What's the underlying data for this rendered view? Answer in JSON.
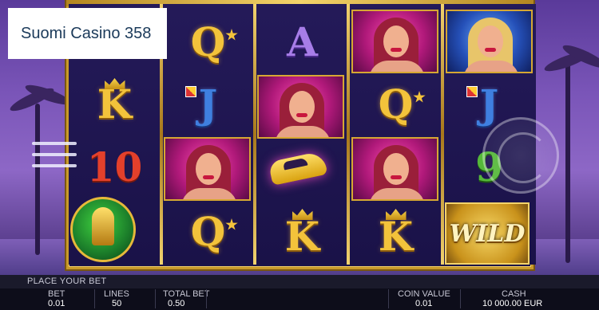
{
  "logo": {
    "text": "Suomi Casino 358"
  },
  "bottom_bar": {
    "place_bet": "PLACE YOUR BET",
    "bet_label": "BET",
    "bet_value": "0.01",
    "lines_label": "LINES",
    "lines_value": "50",
    "total_bet_label": "TOTAL BET",
    "total_bet_value": "0.50",
    "coin_value_label": "COIN VALUE",
    "coin_value": "0.01",
    "cash_label": "CASH",
    "cash_value": "10 000.00 EUR"
  },
  "reels": {
    "r1": [
      "K",
      "10"
    ],
    "r2": [
      "Q",
      "J",
      "Q"
    ],
    "r3": [
      "A",
      "K"
    ],
    "r4": [
      "Q",
      "K"
    ],
    "r5": [
      "J",
      "9",
      "WILD"
    ]
  },
  "icons": [
    "menu-icon",
    "spin-icon",
    "crown-icon",
    "star-icon",
    "trophy-icon",
    "car-icon"
  ]
}
